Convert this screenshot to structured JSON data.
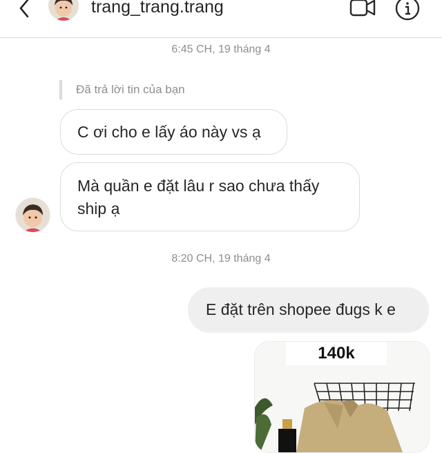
{
  "header": {
    "username": "trang_trang.trang",
    "back_icon": "chevron-left-icon",
    "video_icon": "video-camera-icon",
    "info_icon": "info-icon"
  },
  "thread": {
    "timestamp_1": "6:45 CH, 19 tháng 4",
    "reply_label": "Đã trả lời tin của bạn",
    "incoming": [
      {
        "text": "C ơi cho e lấy áo này vs ạ"
      },
      {
        "line1": "Mà quần e đặt lâu r sao chưa thấy",
        "line2": "ship ạ"
      }
    ],
    "timestamp_2": "8:20 CH, 19 tháng 4",
    "outgoing": [
      {
        "text": "E đặt trên shopee đugs k e"
      }
    ],
    "shared_photo": {
      "price_label": "140k"
    }
  },
  "colors": {
    "incoming_border": "#dbdbdb",
    "outgoing_bg": "#efefef",
    "meta_text": "#8e8e8e",
    "text": "#262626"
  }
}
